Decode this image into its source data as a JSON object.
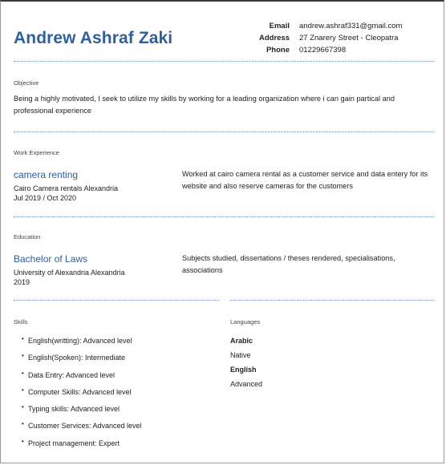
{
  "header": {
    "name": "Andrew Ashraf Zaki",
    "contact": [
      {
        "label": "Email",
        "value": "andrew.ashraf331@gmail.com"
      },
      {
        "label": "Address",
        "value": "27 Znarery Street - Cleopatra"
      },
      {
        "label": "Phone",
        "value": "01229667398"
      }
    ]
  },
  "objective": {
    "title": "Objective",
    "text": "Being a highly motivated, I seek to utilize my skills by working for a leading organization where i can gain partical and professional experience"
  },
  "work": {
    "title": "Work Experience",
    "position": "camera renting",
    "company": "Cairo Camera rentals Alexandria",
    "dates": "Jul 2019 / Oct 2020",
    "description": "Worked at cairo camera rental as a customer service and data entery for its website and also reserve cameras for the customers"
  },
  "education": {
    "title": "Education",
    "degree": "Bachelor of Laws",
    "school": "University of Alexandria Alexandria",
    "year": "2019",
    "description": "Subjects studied, dissertations / theses rendered, specialisations, associations"
  },
  "skills": {
    "title": "Skills",
    "bullet": "•",
    "items": [
      "English(writting): Advanced level",
      "English(Spoken): Intermediate",
      "Data Entry: Advanced level",
      "Computer Skills: Advanced level",
      "Typing skills: Advanced level",
      "Customer Services: Advanced level",
      "Project management: Expert"
    ]
  },
  "languages": {
    "title": "Languages",
    "items": [
      {
        "name": "Arabic",
        "level": "Native"
      },
      {
        "name": "English",
        "level": "Advanced"
      }
    ]
  }
}
